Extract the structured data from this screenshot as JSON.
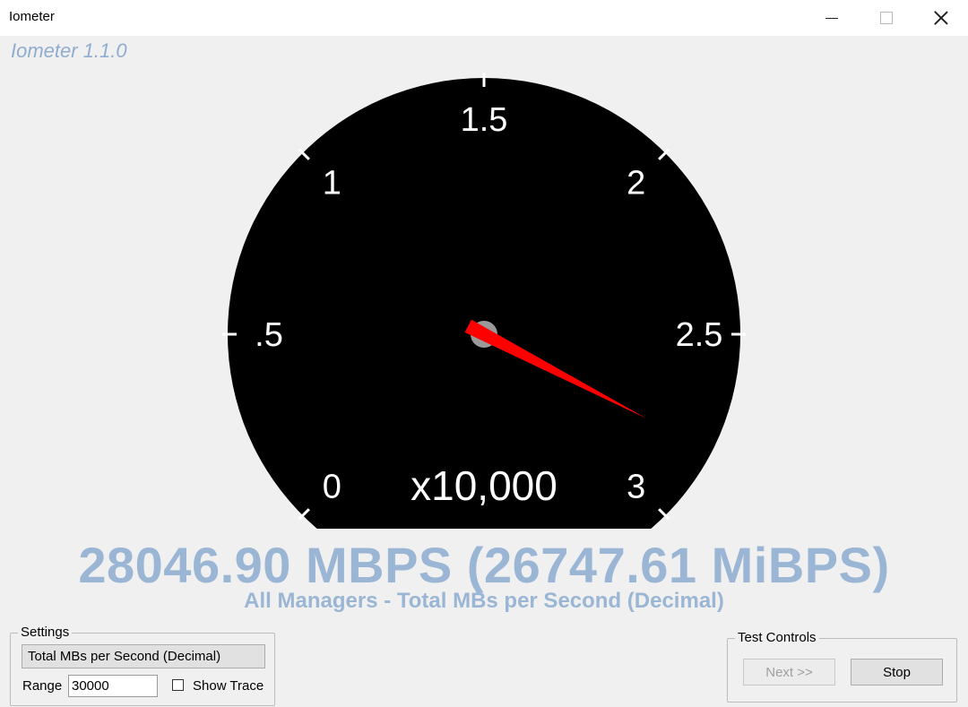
{
  "window": {
    "title": "Iometer",
    "controls": {
      "minimize": "minimize-icon",
      "maximize": "maximize-icon",
      "close": "close-icon"
    }
  },
  "app": {
    "version": "Iometer 1.1.0"
  },
  "gauge": {
    "scale_labels": [
      "0",
      ".5",
      "1",
      "1.5",
      "2",
      "2.5",
      "3"
    ],
    "multiplier": "x10,000",
    "min": 0,
    "max": 3,
    "needle_value": 2.8047,
    "colors": {
      "face": "#000000",
      "text": "#ffffff",
      "needle": "#ff0000",
      "hub": "#9a9a9a"
    }
  },
  "readout": {
    "value": "28046.90 MBPS (26747.61 MiBPS)",
    "subtitle": "All Managers - Total MBs per Second (Decimal)",
    "color": "#9bb6d4"
  },
  "settings": {
    "group_label": "Settings",
    "metric": "Total MBs per Second (Decimal)",
    "range_label": "Range",
    "range_value": "30000",
    "show_trace_label": "Show Trace",
    "show_trace_checked": false
  },
  "test_controls": {
    "group_label": "Test Controls",
    "next_label": "Next >>",
    "next_enabled": false,
    "stop_label": "Stop"
  }
}
